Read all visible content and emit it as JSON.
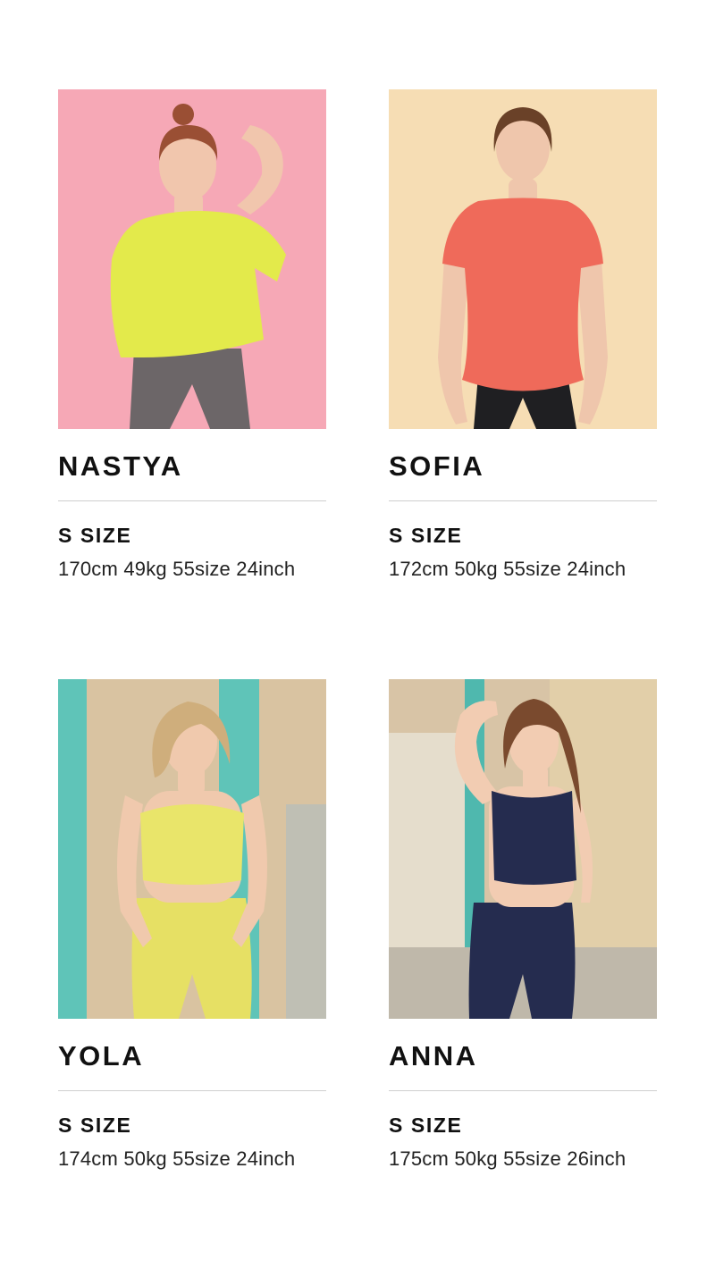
{
  "models": [
    {
      "name": "NASTYA",
      "size_label": "S SIZE",
      "stats": "170cm 49kg 55size 24inch",
      "photo": {
        "background": "#f6a8b6",
        "top_color": "#e3ea4b",
        "bottom_color": "#6c6668",
        "hair_color": "#9a4f34",
        "skin": "#f1c6ad"
      }
    },
    {
      "name": "SOFIA",
      "size_label": "S SIZE",
      "stats": "172cm 50kg 55size 24inch",
      "photo": {
        "background": "#f6ddb4",
        "top_color": "#ef6a5a",
        "bottom_color": "#1f1f22",
        "hair_color": "#6a4128",
        "skin": "#efc6ac"
      }
    },
    {
      "name": "YOLA",
      "size_label": "S SIZE",
      "stats": "174cm 50kg 55size 24inch",
      "photo": {
        "background": "#d9c3a1",
        "top_color": "#e9e56a",
        "bottom_color": "#e6e064",
        "hair_color": "#cfae7c",
        "skin": "#f0c9ad",
        "accent": "#5fc4b8"
      }
    },
    {
      "name": "ANNA",
      "size_label": "S SIZE",
      "stats": "175cm 50kg 55size 26inch",
      "photo": {
        "background": "#d8c4a6",
        "top_color": "#252c4f",
        "bottom_color": "#252c4f",
        "hair_color": "#7a4a2e",
        "skin": "#f2ccb2",
        "accent": "#4fb8ae"
      }
    }
  ]
}
